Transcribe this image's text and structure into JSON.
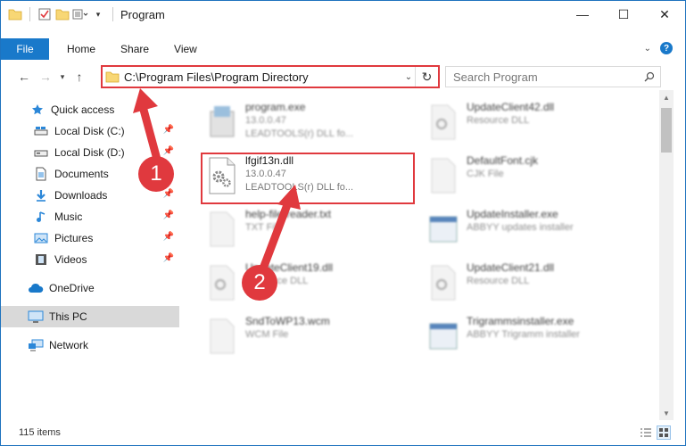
{
  "window": {
    "title": "Program"
  },
  "ribbon": {
    "file": "File",
    "tabs": [
      "Home",
      "Share",
      "View"
    ],
    "help": "?"
  },
  "navigation": {
    "address": "C:\\Program Files\\Program Directory",
    "search_placeholder": "Search Program"
  },
  "sidebar": {
    "items": [
      {
        "label": "Quick access",
        "icon": "star-icon"
      },
      {
        "label": "Local Disk (C:)",
        "icon": "drive-icon",
        "pinned": true
      },
      {
        "label": "Local Disk (D:)",
        "icon": "drive-icon",
        "pinned": true
      },
      {
        "label": "Documents",
        "icon": "documents-icon",
        "pinned": true
      },
      {
        "label": "Downloads",
        "icon": "download-icon",
        "pinned": true
      },
      {
        "label": "Music",
        "icon": "music-icon",
        "pinned": true
      },
      {
        "label": "Pictures",
        "icon": "pictures-icon",
        "pinned": true
      },
      {
        "label": "Videos",
        "icon": "videos-icon",
        "pinned": true
      },
      {
        "label": "OneDrive",
        "icon": "cloud-icon"
      },
      {
        "label": "This PC",
        "icon": "pc-icon",
        "selected": true
      },
      {
        "label": "Network",
        "icon": "network-icon"
      }
    ]
  },
  "files": {
    "left": [
      {
        "name": "program.exe",
        "line1": "13.0.0.47",
        "line2": "LEADTOOLS(r) DLL fo...",
        "icon": "exe-icon"
      },
      {
        "name": "lfgif13n.dll",
        "line1": "13.0.0.47",
        "line2": "LEADTOOLS(r) DLL fo...",
        "icon": "dll-gear-icon"
      },
      {
        "name": "help-file-reader.txt",
        "line1": "TXT File",
        "line2": "",
        "icon": "txt-icon"
      },
      {
        "name": "UpdateClient19.dll",
        "line1": "Resource DLL",
        "line2": "",
        "icon": "dll-icon"
      },
      {
        "name": "SndToWP13.wcm",
        "line1": "WCM File",
        "line2": "",
        "icon": "file-icon"
      }
    ],
    "right": [
      {
        "name": "UpdateClient42.dll",
        "line1": "Resource DLL",
        "line2": "",
        "icon": "dll-icon"
      },
      {
        "name": "DefaultFont.cjk",
        "line1": "CJK File",
        "line2": "",
        "icon": "file-icon"
      },
      {
        "name": "UpdateInstaller.exe",
        "line1": "ABBYY updates installer",
        "line2": "",
        "icon": "installer-icon"
      },
      {
        "name": "UpdateClient21.dll",
        "line1": "Resource DLL",
        "line2": "",
        "icon": "dll-icon"
      },
      {
        "name": "Trigrammsinstaller.exe",
        "line1": "ABBYY Trigramm installer",
        "line2": "",
        "icon": "installer-icon"
      }
    ]
  },
  "status": {
    "items_count": "115 items"
  },
  "annotations": {
    "step1": "1",
    "step2": "2"
  },
  "colors": {
    "accent": "#1979ca",
    "annotation": "#e0393e",
    "selected_bg": "#d9d9d9"
  }
}
